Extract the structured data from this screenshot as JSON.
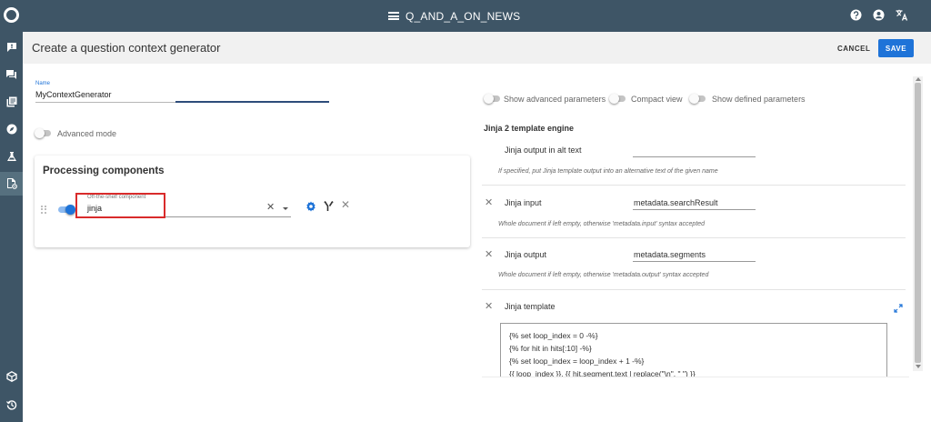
{
  "topbar": {
    "project_name": "Q_AND_A_ON_NEWS"
  },
  "header": {
    "title": "Create a question context generator",
    "cancel_label": "CANCEL",
    "save_label": "SAVE"
  },
  "name_field": {
    "label": "Name",
    "value": "MyContextGenerator"
  },
  "advanced_mode": {
    "label": "Advanced mode",
    "enabled": false
  },
  "processing": {
    "title": "Processing components",
    "component": {
      "label": "Off-the-shelf component",
      "value": "jinja",
      "enabled": true
    }
  },
  "view_options": {
    "show_advanced": "Show advanced parameters",
    "compact_view": "Compact view",
    "show_defined": "Show defined parameters"
  },
  "engine": {
    "title": "Jinja 2 template engine",
    "alt_text": {
      "label": "Jinja output in alt text",
      "value": "",
      "help": "If specified, put Jinja template output into an alternative text of the given name"
    },
    "input": {
      "label": "Jinja input",
      "value": "metadata.searchResult",
      "help": "Whole document if left empty, otherwise 'metadata.input' syntax accepted"
    },
    "output": {
      "label": "Jinja output",
      "value": "metadata.segments",
      "help": "Whole document if left empty, otherwise 'metadata.output' syntax accepted"
    },
    "template": {
      "label": "Jinja template",
      "lines": [
        "{% set loop_index = 0 -%}",
        "{% for hit in hits[:10] -%}",
        "{% set loop_index = loop_index + 1 -%}",
        "{{ loop_index }}. {{ hit.segment.text | replace(\"\\n\", \" \") }}"
      ]
    }
  },
  "colors": {
    "nav": "#3e5566",
    "accent": "#1e73d8",
    "highlight": "#d92b2b"
  }
}
